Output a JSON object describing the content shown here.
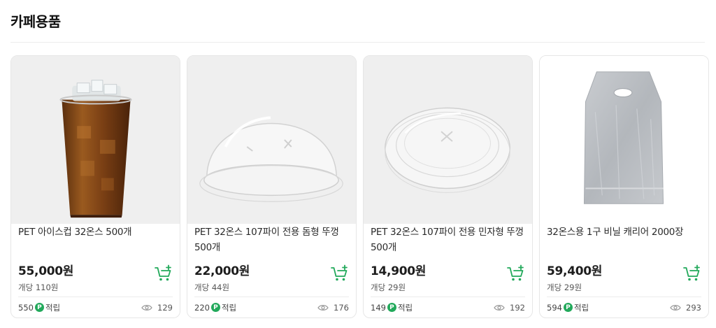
{
  "section": {
    "title": "카페용품"
  },
  "colors": {
    "accent": "#22a95b",
    "image_bg": "#efefef"
  },
  "products": [
    {
      "name": "PET 아이스컵 32온스 500개",
      "price": "55,000원",
      "unit_price": "개당 110원",
      "points_amount": "550",
      "points_badge": "P",
      "points_suffix": "적립",
      "views": "129",
      "image": "iced-coffee-cup-image",
      "cart_icon": "cart-plus-icon",
      "view_icon": "eye-icon"
    },
    {
      "name": "PET 32온스 107파이 전용 돔형 뚜껑 500개",
      "price": "22,000원",
      "unit_price": "개당 44원",
      "points_amount": "220",
      "points_badge": "P",
      "points_suffix": "적립",
      "views": "176",
      "image": "dome-lid-image",
      "cart_icon": "cart-plus-icon",
      "view_icon": "eye-icon"
    },
    {
      "name": "PET 32온스 107파이 전용 민자형 뚜껑 500개",
      "price": "14,900원",
      "unit_price": "개당 29원",
      "points_amount": "149",
      "points_badge": "P",
      "points_suffix": "적립",
      "views": "192",
      "image": "flat-lid-image",
      "cart_icon": "cart-plus-icon",
      "view_icon": "eye-icon"
    },
    {
      "name": "32온스용 1구 비닐 캐리어 2000장",
      "price": "59,400원",
      "unit_price": "개당 29원",
      "points_amount": "594",
      "points_badge": "P",
      "points_suffix": "적립",
      "views": "293",
      "image": "vinyl-carrier-bag-image",
      "cart_icon": "cart-plus-icon",
      "view_icon": "eye-icon"
    }
  ]
}
